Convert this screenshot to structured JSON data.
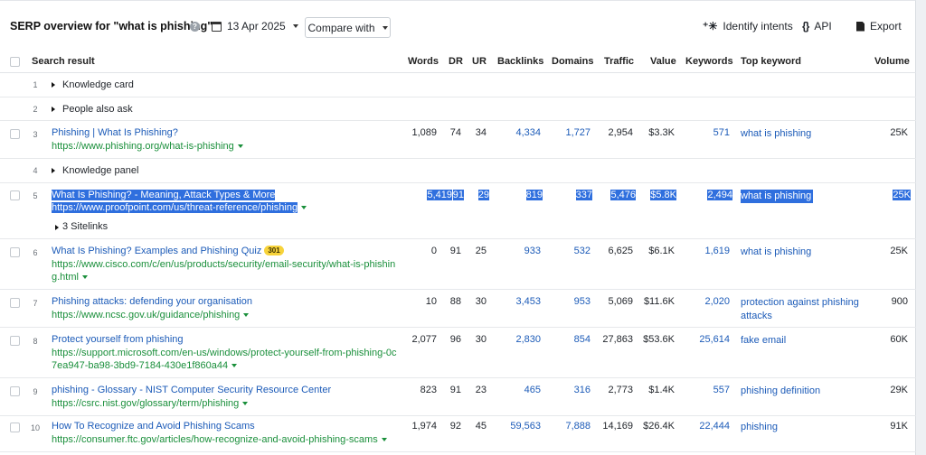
{
  "toolbar": {
    "title": "SERP overview for \"what is phishing\"",
    "help_glyph": "?",
    "date": "13 Apr 2025",
    "compare_label": "Compare with",
    "identify_label": "Identify intents",
    "api_label": "API",
    "api_glyph": "{}",
    "export_label": "Export",
    "spark_glyph": "⁺✳"
  },
  "columns": {
    "search_result": "Search result",
    "words": "Words",
    "dr": "DR",
    "ur": "UR",
    "backlinks": "Backlinks",
    "domains": "Domains",
    "traffic": "Traffic",
    "value": "Value",
    "keywords": "Keywords",
    "top_keyword": "Top keyword",
    "volume": "Volume"
  },
  "serp_features": [
    {
      "pos": "1",
      "label": "Knowledge card"
    },
    {
      "pos": "2",
      "label": "People also ask"
    },
    {
      "pos": "4",
      "label": "Knowledge panel"
    }
  ],
  "sitelinks_label": "3 Sitelinks",
  "results": [
    {
      "pos": "3",
      "title": "Phishing | What Is Phishing?",
      "url": "https://www.phishing.org/what-is-phishing",
      "words": "1,089",
      "dr": "74",
      "ur": "34",
      "backlinks": "4,334",
      "domains": "1,727",
      "traffic": "2,954",
      "value": "$3.3K",
      "keywords": "571",
      "top_keyword": "what is phishing",
      "volume": "25K"
    },
    {
      "pos": "5",
      "title": "What Is Phishing? - Meaning, Attack Types & More",
      "url": "https://www.proofpoint.com/us/threat-reference/phishing",
      "words": "5,419",
      "dr": "91",
      "ur": "29",
      "backlinks": "819",
      "domains": "337",
      "traffic": "5,476",
      "value": "$5.8K",
      "keywords": "2,494",
      "top_keyword": "what is phishing",
      "volume": "25K"
    },
    {
      "pos": "6",
      "title": "What Is Phishing? Examples and Phishing Quiz",
      "badge": "301",
      "url_line1": "https://www.cisco.com/c/en/us/products/security/email-security/what-is-phishin",
      "url_line2": "g.html",
      "words": "0",
      "dr": "91",
      "ur": "25",
      "backlinks": "933",
      "domains": "532",
      "traffic": "6,625",
      "value": "$6.1K",
      "keywords": "1,619",
      "top_keyword": "what is phishing",
      "volume": "25K"
    },
    {
      "pos": "7",
      "title": "Phishing attacks: defending your organisation",
      "url": "https://www.ncsc.gov.uk/guidance/phishing",
      "words": "10",
      "dr": "88",
      "ur": "30",
      "backlinks": "3,453",
      "domains": "953",
      "traffic": "5,069",
      "value": "$11.6K",
      "keywords": "2,020",
      "top_keyword_line1": "protection against phishing",
      "top_keyword_line2": "attacks",
      "volume": "900"
    },
    {
      "pos": "8",
      "title": "Protect yourself from phishing",
      "url_line1": "https://support.microsoft.com/en-us/windows/protect-yourself-from-phishing-0c",
      "url_line2": "7ea947-ba98-3bd9-7184-430e1f860a44",
      "words": "2,077",
      "dr": "96",
      "ur": "30",
      "backlinks": "2,830",
      "domains": "854",
      "traffic": "27,863",
      "value": "$53.6K",
      "keywords": "25,614",
      "top_keyword": "fake email",
      "volume": "60K"
    },
    {
      "pos": "9",
      "title": "phishing - Glossary - NIST Computer Security Resource Center",
      "url": "https://csrc.nist.gov/glossary/term/phishing",
      "words": "823",
      "dr": "91",
      "ur": "23",
      "backlinks": "465",
      "domains": "316",
      "traffic": "2,773",
      "value": "$1.4K",
      "keywords": "557",
      "top_keyword": "phishing definition",
      "volume": "29K"
    },
    {
      "pos": "10",
      "title": "How To Recognize and Avoid Phishing Scams",
      "url": "https://consumer.ftc.gov/articles/how-recognize-and-avoid-phishing-scams",
      "words": "1,974",
      "dr": "92",
      "ur": "45",
      "backlinks": "59,563",
      "domains": "7,888",
      "traffic": "14,169",
      "value": "$26.4K",
      "keywords": "22,444",
      "top_keyword": "phishing",
      "volume": "91K"
    }
  ],
  "colors": {
    "link": "#1c5bb8",
    "url": "#1a8f3b",
    "selection": "#2f6fde",
    "badge": "#f7d33b"
  }
}
